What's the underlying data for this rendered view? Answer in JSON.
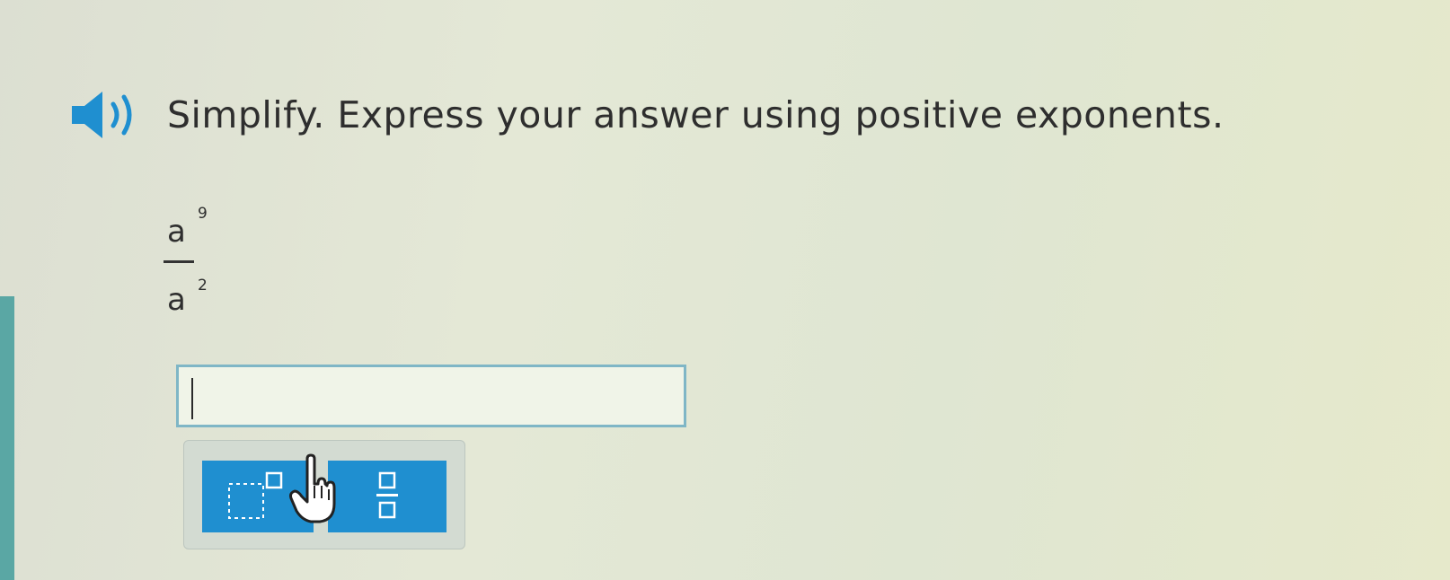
{
  "question": {
    "prompt": "Simplify. Express your answer using positive exponents.",
    "audio_icon": "speaker-icon"
  },
  "expression": {
    "numerator_base": "a",
    "numerator_exponent": "9",
    "denominator_base": "a",
    "denominator_exponent": "2"
  },
  "answer": {
    "value": ""
  },
  "toolbar": {
    "buttons": [
      {
        "icon": "exponent-template-icon"
      },
      {
        "icon": "fraction-template-icon"
      }
    ]
  },
  "colors": {
    "accent": "#1f8fd0",
    "input_border": "#7fb6c6",
    "side_strip": "#5aa7a4"
  }
}
